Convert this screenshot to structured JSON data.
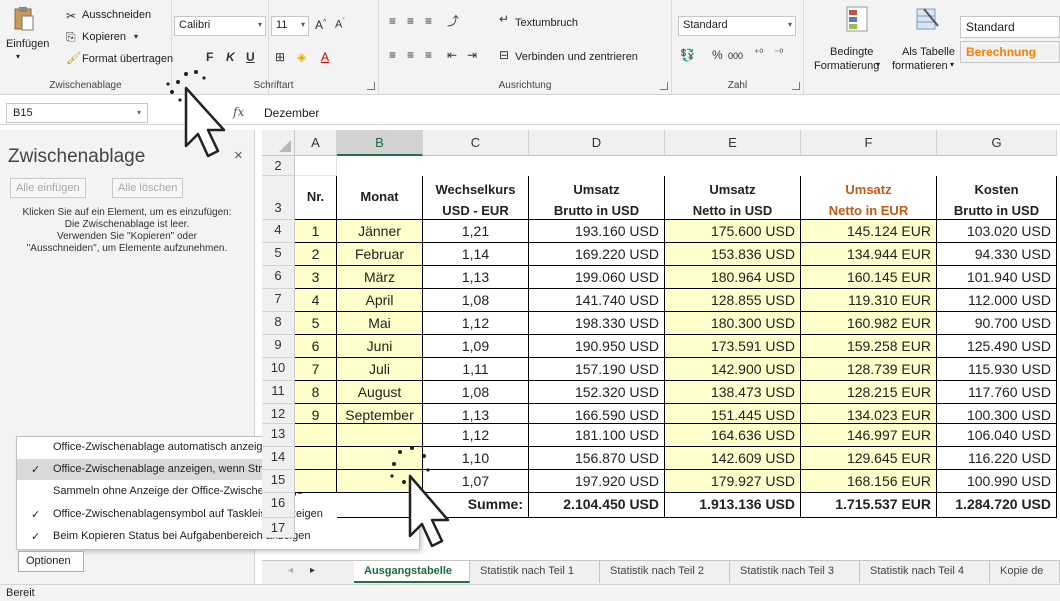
{
  "ribbon": {
    "clipboard": {
      "paste": "Einfügen",
      "cut": "Ausschneiden",
      "copy": "Kopieren",
      "format_painter": "Format übertragen",
      "label": "Zwischenablage"
    },
    "font": {
      "name": "Calibri",
      "size": "11",
      "bold": "F",
      "italic": "K",
      "underline": "U",
      "label": "Schriftart"
    },
    "alignment": {
      "wrap": "Textumbruch",
      "merge": "Verbinden und zentrieren",
      "label": "Ausrichtung"
    },
    "number": {
      "format": "Standard",
      "percent": "%",
      "thousands": "000",
      "label": "Zahl"
    },
    "styles": {
      "conditional_line1": "Bedingte",
      "conditional_line2": "Formatierung",
      "table_line1": "Als Tabelle",
      "table_line2": "formatieren",
      "style_standard": "Standard",
      "style_calc": "Berechnung"
    }
  },
  "formula_bar": {
    "cell": "B15",
    "fx": "fx",
    "value": "Dezember"
  },
  "pane": {
    "title": "Zwischenablage",
    "close": "×",
    "paste_all": "Alle einfügen",
    "clear_all": "Alle löschen",
    "info_lines": [
      "Klicken Sie auf ein Element, um es einzufügen:",
      "Die Zwischenablage ist leer.",
      "Verwenden Sie \"Kopieren\" oder",
      "\"Ausschneiden\", um Elemente aufzunehmen."
    ],
    "menu": [
      {
        "label": "Office-Zwischenablage automatisch anzeigen",
        "checked": false
      },
      {
        "label": "Office-Zwischenablage anzeigen, wenn Strg+C zweimal gedrückt wurde",
        "checked": true
      },
      {
        "label": "Sammeln ohne Anzeige der Office-Zwischenablage",
        "checked": false
      },
      {
        "label": "Office-Zwischenablagensymbol auf Taskleiste anzeigen",
        "checked": true
      },
      {
        "label": "Beim Kopieren Status bei Aufgabenbereich anzeigen",
        "checked": true
      }
    ],
    "check_mark": "✓",
    "options_button": "Optionen"
  },
  "sheet": {
    "columns": [
      "A",
      "B",
      "C",
      "D",
      "E",
      "F",
      "G"
    ],
    "row_numbers": [
      "2",
      "3",
      "4",
      "5",
      "6",
      "7",
      "8",
      "9",
      "10",
      "11",
      "12",
      "13",
      "14",
      "15",
      "16",
      "17"
    ],
    "headers": {
      "nr": "Nr.",
      "monat": "Monat",
      "kurs_1": "Wechselkurs",
      "kurs_2": "USD - EUR",
      "ub_1": "Umsatz",
      "ub_2": "Brutto in USD",
      "un_1": "Umsatz",
      "un_2": "Netto in USD",
      "ue_1": "Umsatz",
      "ue_2": "Netto in EUR",
      "kb_1": "Kosten",
      "kb_2": "Brutto in USD"
    },
    "rows": [
      {
        "nr": "1",
        "monat": "Jänner",
        "kurs": "1,21",
        "ub": "193.160 USD",
        "un": "175.600 USD",
        "ue": "145.124 EUR",
        "kb": "103.020 USD"
      },
      {
        "nr": "2",
        "monat": "Februar",
        "kurs": "1,14",
        "ub": "169.220 USD",
        "un": "153.836 USD",
        "ue": "134.944 EUR",
        "kb": "94.330 USD"
      },
      {
        "nr": "3",
        "monat": "März",
        "kurs": "1,13",
        "ub": "199.060 USD",
        "un": "180.964 USD",
        "ue": "160.145 EUR",
        "kb": "101.940 USD"
      },
      {
        "nr": "4",
        "monat": "April",
        "kurs": "1,08",
        "ub": "141.740 USD",
        "un": "128.855 USD",
        "ue": "119.310 EUR",
        "kb": "112.000 USD"
      },
      {
        "nr": "5",
        "monat": "Mai",
        "kurs": "1,12",
        "ub": "198.330 USD",
        "un": "180.300 USD",
        "ue": "160.982 EUR",
        "kb": "90.700 USD"
      },
      {
        "nr": "6",
        "monat": "Juni",
        "kurs": "1,09",
        "ub": "190.950 USD",
        "un": "173.591 USD",
        "ue": "159.258 EUR",
        "kb": "125.490 USD"
      },
      {
        "nr": "7",
        "monat": "Juli",
        "kurs": "1,11",
        "ub": "157.190 USD",
        "un": "142.900 USD",
        "ue": "128.739 EUR",
        "kb": "115.930 USD"
      },
      {
        "nr": "8",
        "monat": "August",
        "kurs": "1,08",
        "ub": "152.320 USD",
        "un": "138.473 USD",
        "ue": "128.215 EUR",
        "kb": "117.760 USD"
      },
      {
        "nr": "9",
        "monat": "September",
        "kurs": "1,13",
        "ub": "166.590 USD",
        "un": "151.445 USD",
        "ue": "134.023 EUR",
        "kb": "100.300 USD"
      },
      {
        "nr": "",
        "monat": "",
        "kurs": "1,12",
        "ub": "181.100 USD",
        "un": "164.636 USD",
        "ue": "146.997 EUR",
        "kb": "106.040 USD"
      },
      {
        "nr": "",
        "monat": "",
        "kurs": "1,10",
        "ub": "156.870 USD",
        "un": "142.609 USD",
        "ue": "129.645 EUR",
        "kb": "116.220 USD"
      },
      {
        "nr": "",
        "monat": "",
        "kurs": "1,07",
        "ub": "197.920 USD",
        "un": "179.927 USD",
        "ue": "168.156 EUR",
        "kb": "100.990 USD"
      }
    ],
    "sum": {
      "label": "Summe:",
      "ub": "2.104.450 USD",
      "un": "1.913.136 USD",
      "ue": "1.715.537 EUR",
      "kb": "1.284.720 USD"
    }
  },
  "tabs": [
    "Ausgangstabelle",
    "Statistik nach Teil 1",
    "Statistik nach Teil 2",
    "Statistik nach Teil 3",
    "Statistik nach Teil 4",
    "Kopie de"
  ],
  "status": "Bereit",
  "colors": {
    "accent": "#217346",
    "highlight": "#ffffcc",
    "orange": "#c55a11"
  }
}
